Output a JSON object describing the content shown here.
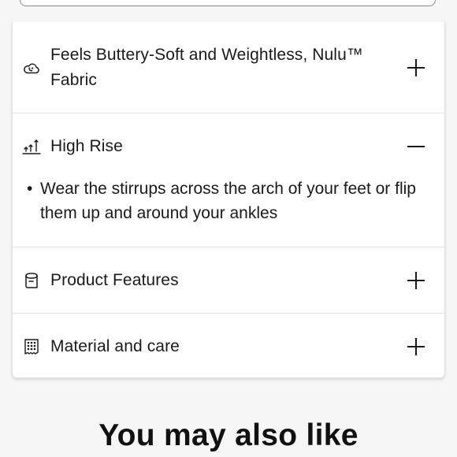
{
  "accordion": {
    "items": [
      {
        "label": "Feels Buttery-Soft and Weightless, Nulu™ Fabric",
        "icon": "cloud-smile-icon",
        "expanded": false
      },
      {
        "label": "High Rise",
        "icon": "rise-arrows-icon",
        "expanded": true,
        "details": [
          "Wear the stirrups across the arch of your feet or flip them up and around your ankles"
        ]
      },
      {
        "label": "Product Features",
        "icon": "fabric-roll-icon",
        "expanded": false
      },
      {
        "label": "Material and care",
        "icon": "care-tag-icon",
        "expanded": false
      }
    ]
  },
  "recommendations": {
    "heading": "You may also like"
  }
}
